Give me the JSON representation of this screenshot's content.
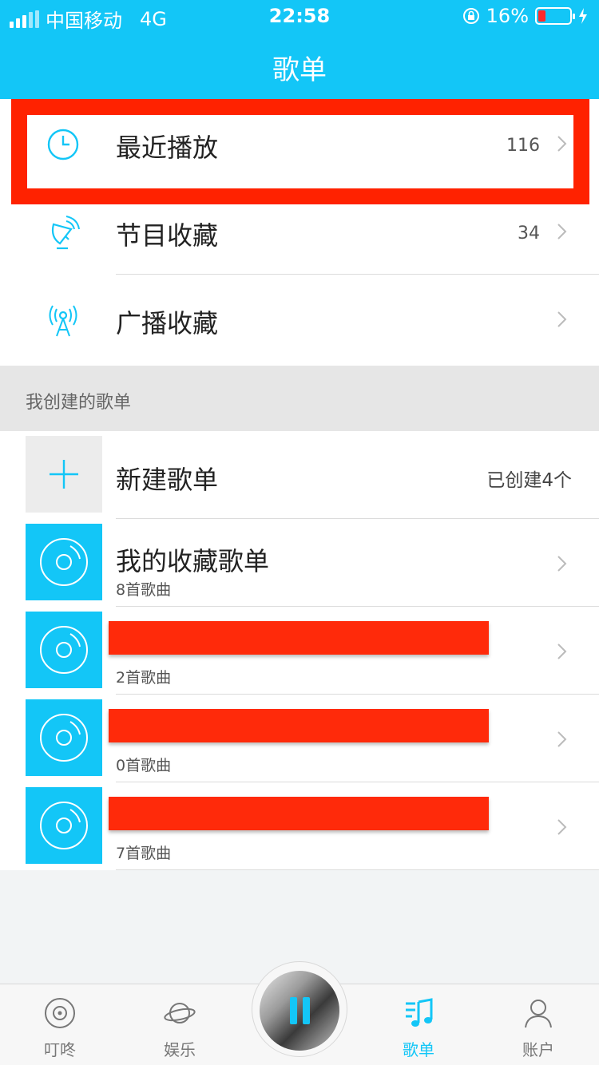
{
  "status": {
    "carrier": "中国移动",
    "network": "4G",
    "time": "22:58",
    "battery": "16%"
  },
  "header": {
    "title": "歌单"
  },
  "top_items": [
    {
      "label": "最近播放",
      "count": "116",
      "icon": "clock-icon"
    },
    {
      "label": "节目收藏",
      "count": "34",
      "icon": "satellite-dish-icon"
    },
    {
      "label": "广播收藏",
      "count": "",
      "icon": "radio-tower-icon"
    }
  ],
  "section": {
    "label": "我创建的歌单"
  },
  "new_playlist": {
    "label": "新建歌单",
    "created": "已创建4个"
  },
  "playlists": [
    {
      "title": "我的收藏歌单",
      "songs": "8首歌曲"
    },
    {
      "title": "",
      "songs": "2首歌曲"
    },
    {
      "title": "",
      "songs": "0首歌曲"
    },
    {
      "title": "",
      "songs": "7首歌曲"
    }
  ],
  "tabs": [
    {
      "label": "叮咚",
      "icon": "dingdong-icon"
    },
    {
      "label": "娱乐",
      "icon": "planet-icon"
    },
    {
      "label": "歌单",
      "icon": "music-note-icon"
    },
    {
      "label": "账户",
      "icon": "account-icon"
    }
  ],
  "colors": {
    "accent": "#13c6f7",
    "highlight": "#ff2200",
    "battery_low": "#ff2a2a"
  }
}
